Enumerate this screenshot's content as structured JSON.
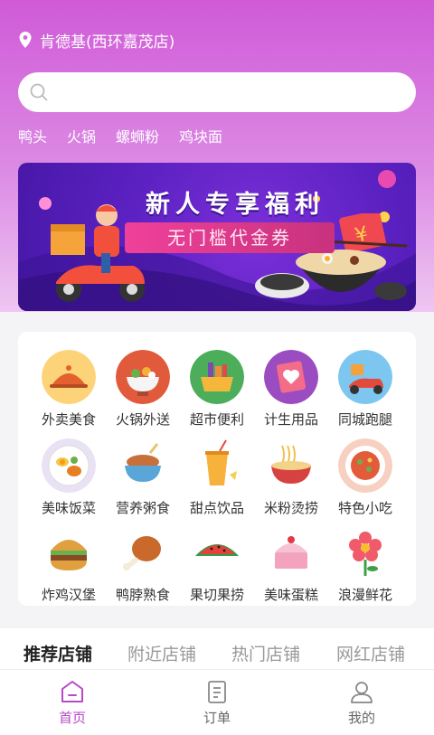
{
  "location": {
    "name": "肯德基(西环嘉茂店)"
  },
  "search": {
    "placeholder": ""
  },
  "hot_tags": [
    "鸭头",
    "火锅",
    "螺蛳粉",
    "鸡块面"
  ],
  "banner": {
    "title": "新人专享福利",
    "subtitle": "无门槛代金券"
  },
  "categories": [
    {
      "label": "外卖美食",
      "icon": "food-cloche-icon"
    },
    {
      "label": "火锅外送",
      "icon": "hotpot-icon"
    },
    {
      "label": "超市便利",
      "icon": "grocery-basket-icon"
    },
    {
      "label": "计生用品",
      "icon": "heart-card-icon"
    },
    {
      "label": "同城跑腿",
      "icon": "delivery-scooter-icon"
    },
    {
      "label": "美味饭菜",
      "icon": "meal-plate-icon"
    },
    {
      "label": "营养粥食",
      "icon": "porridge-bowl-icon"
    },
    {
      "label": "甜点饮品",
      "icon": "drink-cup-icon"
    },
    {
      "label": "米粉烫捞",
      "icon": "noodle-bowl-icon"
    },
    {
      "label": "特色小吃",
      "icon": "snack-plate-icon"
    },
    {
      "label": "炸鸡汉堡",
      "icon": "burger-icon"
    },
    {
      "label": "鸭脖熟食",
      "icon": "drumstick-icon"
    },
    {
      "label": "果切果捞",
      "icon": "watermelon-icon"
    },
    {
      "label": "美味蛋糕",
      "icon": "cake-icon"
    },
    {
      "label": "浪漫鲜花",
      "icon": "flower-icon"
    }
  ],
  "store_tabs": [
    "推荐店铺",
    "附近店铺",
    "热门店铺",
    "网红店铺"
  ],
  "tabbar": [
    {
      "label": "首页",
      "icon": "home-icon"
    },
    {
      "label": "订单",
      "icon": "order-list-icon"
    },
    {
      "label": "我的",
      "icon": "user-icon"
    }
  ],
  "colors": {
    "accent": "#b948c9",
    "header_top": "#d05ad8",
    "banner_bg": "#5a20c0"
  }
}
